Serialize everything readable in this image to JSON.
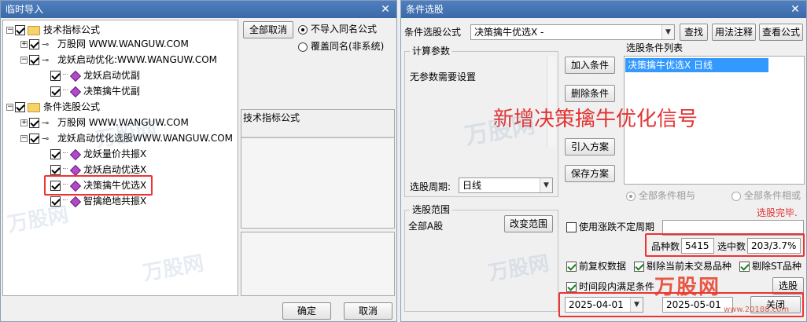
{
  "left": {
    "title": "临时导入",
    "close": "✕",
    "tree": {
      "root1": "技术指标公式",
      "r1c1": "万股网 WWW.WANGUW.COM",
      "r1c2": "龙妖启动优化:WWW.WANGUW.COM",
      "r1c2a": "龙妖启动优副",
      "r1c2b": "决策擒牛优副",
      "root2": "条件选股公式",
      "r2c1": "万股网 WWW.WANGUW.COM",
      "r2c2": "龙妖启动优化选股WWW.WANGUW.COM",
      "r2c2a": "龙妖量价共振X",
      "r2c2b": "龙妖启动优选X",
      "r2c2c": "决策擒牛优选X",
      "r2c2d": "智擒绝地共振X"
    },
    "cancel_all": "全部取消",
    "radio_skip": "不导入同名公式",
    "radio_overwrite": "覆盖同名(非系统)",
    "formula_label": "技术指标公式",
    "ok": "确定",
    "cancel": "取消"
  },
  "right": {
    "title": "条件选股",
    "close": "✕",
    "formula_label": "条件选股公式",
    "formula_value": "决策擒牛优选X  -",
    "btn_search": "查找",
    "btn_usage": "用法注释",
    "btn_view": "查看公式",
    "calc_params": "计算参数",
    "no_params": "无参数需要设置",
    "btn_add": "加入条件",
    "btn_delete": "删除条件",
    "btn_import": "引入方案",
    "btn_save": "保存方案",
    "cond_list_label": "选股条件列表",
    "cond_item": "决策擒牛优选X  日线",
    "overlay": "新增决策擒牛优化信号",
    "all_and": "全部条件相与",
    "all_or": "全部条件相或",
    "period_label": "选股周期:",
    "period_value": "日线",
    "done": "选股完毕.",
    "range_label": "选股范围",
    "range_value": "全部A股",
    "btn_change_range": "改变范围",
    "use_variable": "使用涨跌不定周期",
    "count_label": "品种数",
    "count_value": "5415",
    "selected_label": "选中数",
    "selected_value": "203/3.7%",
    "adj": "前复权数据",
    "exclude_untraded": "剔除当前未交易品种",
    "exclude_st": "剔除ST品种",
    "time_cond": "时间段内满足条件",
    "btn_stock": "选股",
    "date_from": "2025-04-01",
    "date_to": "2025-05-01",
    "btn_close": "关闭"
  },
  "watermarks": {
    "logo": "万股网",
    "url": "www.20188.com"
  },
  "colors": {
    "accent": "#3b6aa8",
    "highlight": "#e33333",
    "selection": "#3399ff"
  }
}
